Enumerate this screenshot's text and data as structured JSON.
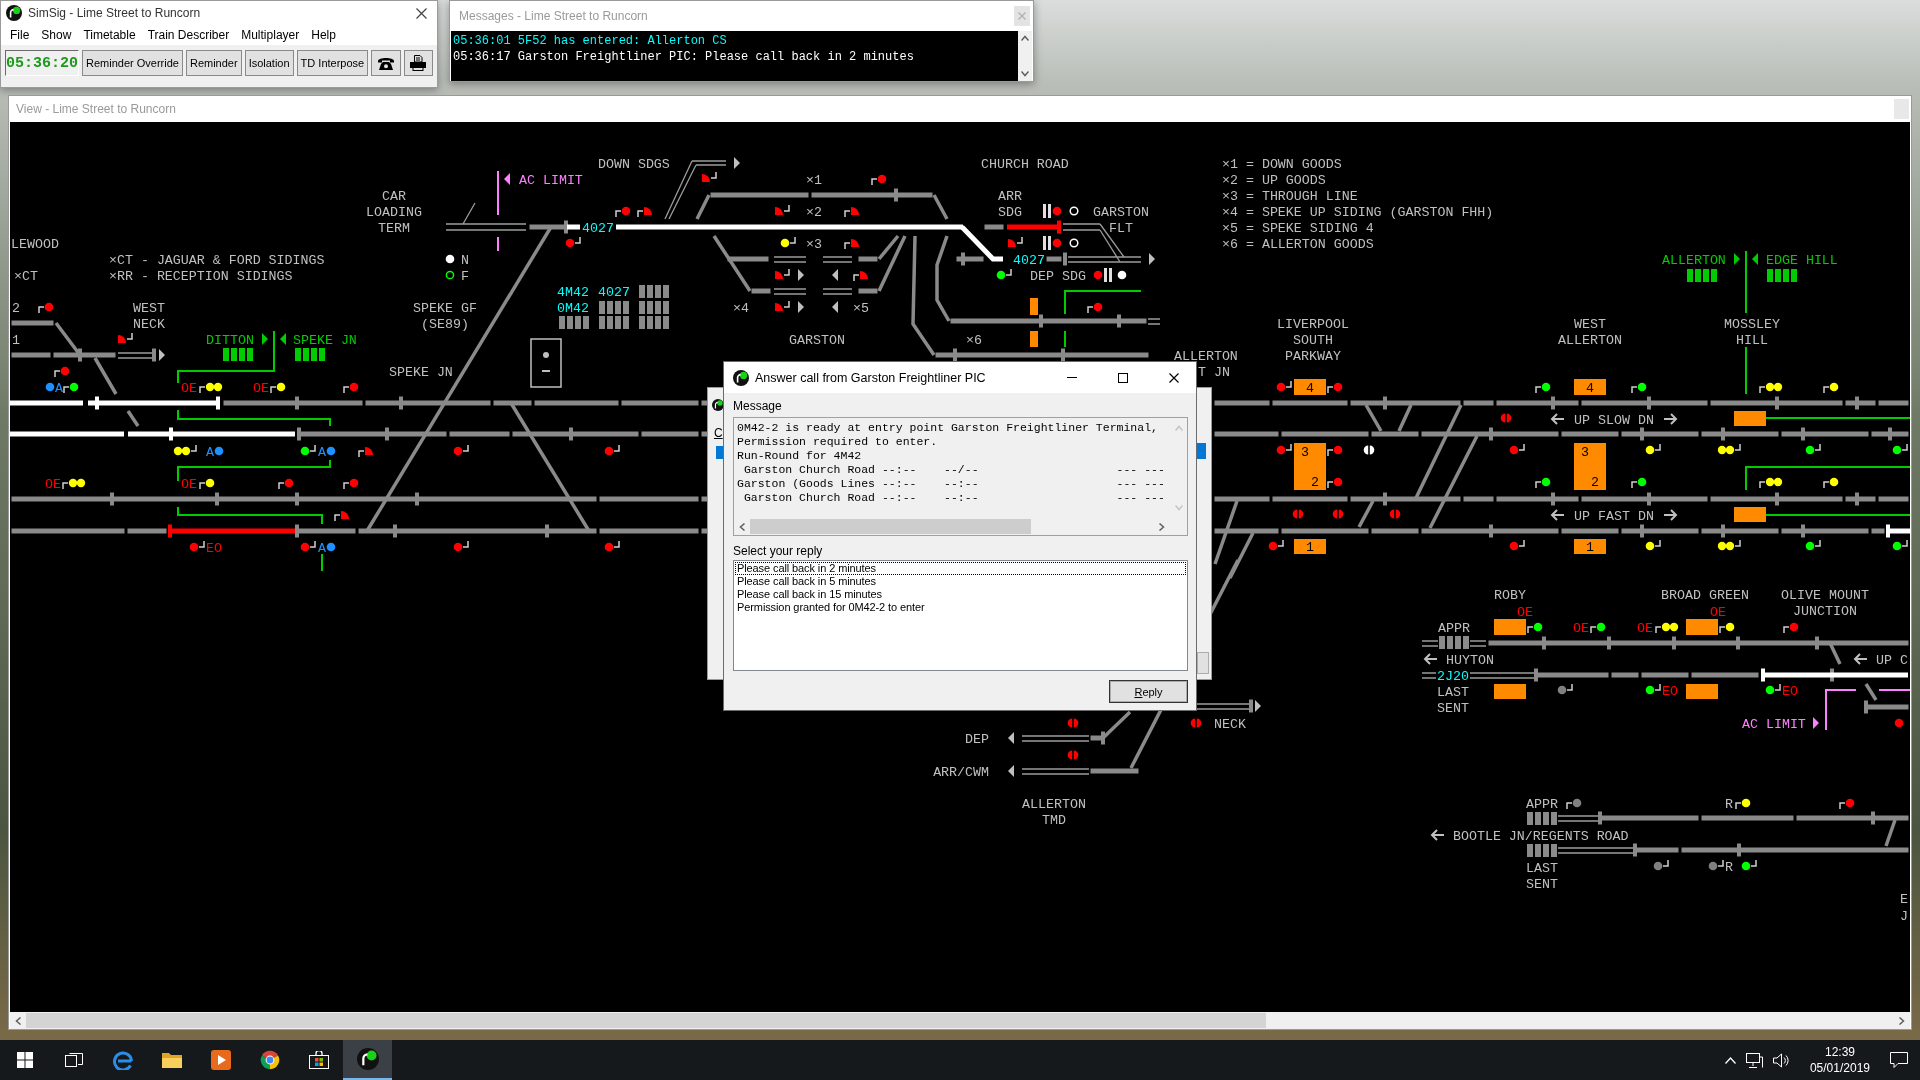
{
  "main_window": {
    "title": "SimSig - Lime Street to Runcorn",
    "menu": [
      "File",
      "Show",
      "Timetable",
      "Train Describer",
      "Multiplayer",
      "Help"
    ],
    "clock": "05:36:20",
    "toolbar": [
      {
        "kind": "text",
        "label": "Reminder Override"
      },
      {
        "kind": "text",
        "label": "Reminder"
      },
      {
        "kind": "text",
        "label": "Isolation"
      },
      {
        "kind": "text",
        "label": "TD Interpose"
      },
      {
        "kind": "phone"
      },
      {
        "kind": "printer"
      }
    ]
  },
  "messages_window": {
    "title": "Messages - Lime Street to Runcorn",
    "lines": [
      {
        "text": "05:36:01 5F52 has entered: Allerton CS",
        "color": "#00ffff"
      },
      {
        "text": "05:36:17 Garston Freightliner PIC: Please call back in 2 minutes",
        "color": "#ffffff"
      }
    ]
  },
  "view_window": {
    "title": "View - Lime Street to Runcorn",
    "schematic": {
      "labels": [
        {
          "kind": "name",
          "text": "DOWN SDGS"
        },
        {
          "kind": "name",
          "text": "CHURCH ROAD"
        },
        {
          "kind": "limit",
          "text": "AC LIMIT"
        },
        {
          "kind": "marker",
          "text": "×1"
        },
        {
          "kind": "name",
          "lines": [
            "CAR",
            "LOADING",
            "TERM"
          ]
        },
        {
          "kind": "marker",
          "text": "×2"
        },
        {
          "kind": "name",
          "lines": [
            "ARR",
            "SDG"
          ]
        },
        {
          "kind": "name",
          "lines": [
            "GARSTON",
            "FLT"
          ]
        },
        {
          "kind": "name",
          "text": "LEWOOD"
        },
        {
          "kind": "marker",
          "text": "×3"
        },
        {
          "kind": "name",
          "text": "×CT - JAGUAR & FORD SIDINGS"
        },
        {
          "kind": "key",
          "text": "N"
        },
        {
          "kind": "fringe",
          "text": "ALLERTON"
        },
        {
          "kind": "fringe",
          "text": "EDGE HILL"
        },
        {
          "kind": "name",
          "text": "×CT"
        },
        {
          "kind": "name",
          "text": "×RR - RECEPTION SIDINGS"
        },
        {
          "kind": "key",
          "text": "F"
        },
        {
          "kind": "name",
          "text": "DEP SDG"
        },
        {
          "kind": "number",
          "text": "2"
        },
        {
          "kind": "name",
          "lines": [
            "WEST",
            "NECK"
          ]
        },
        {
          "kind": "name",
          "lines": [
            "SPEKE GF",
            "(SE89)"
          ]
        },
        {
          "kind": "marker",
          "text": "×4"
        },
        {
          "kind": "marker",
          "text": "×5"
        },
        {
          "kind": "number",
          "text": "1"
        },
        {
          "kind": "fringe",
          "text": "DITTON"
        },
        {
          "kind": "fringe",
          "text": "SPEKE JN"
        },
        {
          "kind": "name",
          "text": "GARSTON"
        },
        {
          "kind": "marker",
          "text": "×6"
        },
        {
          "kind": "name",
          "lines": [
            "LIVERPOOL",
            "SOUTH",
            "PARKWAY"
          ]
        },
        {
          "kind": "name",
          "lines": [
            "WEST",
            "ALLERTON"
          ]
        },
        {
          "kind": "name",
          "lines": [
            "MOSSLEY",
            "HILL"
          ]
        },
        {
          "kind": "name",
          "text": "ALLERTON"
        },
        {
          "kind": "name",
          "text": "SPEKE JN"
        },
        {
          "kind": "name",
          "text": "T JN"
        },
        {
          "kind": "name",
          "text": "UP SLOW DN"
        },
        {
          "kind": "name",
          "text": "UP FAST DN"
        },
        {
          "kind": "name",
          "text": "ROBY"
        },
        {
          "kind": "name",
          "text": "BROAD GREEN"
        },
        {
          "kind": "name",
          "lines": [
            "OLIVE MOUNT",
            "JUNCTION"
          ]
        },
        {
          "kind": "name",
          "text": "APPR"
        },
        {
          "kind": "name",
          "text": "HUYTON"
        },
        {
          "kind": "name",
          "text": "UP C"
        },
        {
          "kind": "name",
          "lines": [
            "LAST",
            "SENT"
          ]
        },
        {
          "kind": "name",
          "text": "NECK"
        },
        {
          "kind": "limit",
          "text": "AC LIMIT"
        },
        {
          "kind": "name",
          "text": "DEP"
        },
        {
          "kind": "name",
          "text": "ARR/CWM"
        },
        {
          "kind": "name",
          "lines": [
            "ALLERTON",
            "TMD"
          ]
        },
        {
          "kind": "name",
          "text": "APPR"
        },
        {
          "kind": "name",
          "text": "BOOTLE JN/REGENTS ROAD"
        },
        {
          "kind": "name",
          "lines": [
            "LAST",
            "SENT"
          ]
        },
        {
          "kind": "name",
          "text": "E"
        },
        {
          "kind": "name",
          "text": "J"
        }
      ],
      "legend": [
        "×1 = DOWN GOODS",
        "×2 = UP GOODS",
        "×3 = THROUGH LINE",
        "×4 = SPEKE UP SIDING (GARSTON FHH)",
        "×5 = SPEKE SIDING 4",
        "×6 = ALLERTON GOODS"
      ],
      "train_ids": [
        {
          "text": "4027"
        },
        {
          "text": "4M42"
        },
        {
          "text": "4027"
        },
        {
          "text": "0M42"
        },
        {
          "text": "4027"
        },
        {
          "text": "2J20"
        }
      ],
      "route_letters": [
        {
          "text": "A",
          "color": "#1e90ff"
        },
        {
          "text": "OE",
          "color": "#ff0000"
        },
        {
          "text": "OE",
          "color": "#ff0000"
        },
        {
          "text": "A",
          "color": "#1e90ff"
        },
        {
          "text": "A",
          "color": "#1e90ff"
        },
        {
          "text": "OE",
          "color": "#ff0000"
        },
        {
          "text": "OE",
          "color": "#ff0000"
        },
        {
          "text": "EO",
          "color": "#ff0000"
        },
        {
          "text": "A",
          "color": "#1e90ff"
        },
        {
          "text": "OE",
          "color": "#ff0000"
        },
        {
          "text": "OE",
          "color": "#ff0000"
        },
        {
          "text": "OE",
          "color": "#ff0000"
        },
        {
          "text": "OE",
          "color": "#ff0000"
        },
        {
          "text": "EO",
          "color": "#ff0000"
        },
        {
          "text": "EO",
          "color": "#ff0000"
        },
        {
          "text": "R",
          "color": "#c0c0c0"
        },
        {
          "text": "R",
          "color": "#c0c0c0"
        }
      ],
      "signals": [
        {
          "kind": "main",
          "color": "#ff0000"
        },
        {
          "kind": "shunt",
          "color": "#ff0000"
        },
        {
          "kind": "main",
          "color": "#ff0000"
        },
        {
          "kind": "main",
          "color": "#1e90ff"
        },
        {
          "kind": "main",
          "color": "#00ff00"
        },
        {
          "kind": "double",
          "color": "#ffff00"
        },
        {
          "kind": "main",
          "color": "#ffff00"
        },
        {
          "kind": "main",
          "color": "#ff0000"
        },
        {
          "kind": "double",
          "color": "#ffff00"
        },
        {
          "kind": "main",
          "color": "#1e90ff"
        },
        {
          "kind": "main",
          "color": "#00ff00"
        },
        {
          "kind": "main",
          "color": "#1e90ff"
        },
        {
          "kind": "shunt",
          "color": "#ff0000"
        },
        {
          "kind": "main",
          "color": "#ff0000"
        },
        {
          "kind": "main",
          "color": "#ff0000"
        },
        {
          "kind": "double",
          "color": "#ffff00"
        },
        {
          "kind": "main",
          "color": "#ffff00"
        },
        {
          "kind": "main",
          "color": "#ff0000"
        },
        {
          "kind": "main",
          "color": "#ff0000"
        },
        {
          "kind": "shunt",
          "color": "#ff0000"
        },
        {
          "kind": "main",
          "color": "#ff0000"
        },
        {
          "kind": "main",
          "color": "#ff0000"
        },
        {
          "kind": "main",
          "color": "#1e90ff"
        },
        {
          "kind": "main",
          "color": "#ff0000"
        },
        {
          "kind": "main",
          "color": "#ff0000"
        },
        {
          "kind": "shunt",
          "color": "#ff0000"
        },
        {
          "kind": "main",
          "color": "#ff0000"
        },
        {
          "kind": "shunt",
          "color": "#ff0000"
        },
        {
          "kind": "main",
          "color": "#ff0000"
        },
        {
          "kind": "main",
          "color": "#ff0000"
        },
        {
          "kind": "shunt",
          "color": "#ff0000"
        },
        {
          "kind": "shunt",
          "color": "#ff0000"
        },
        {
          "kind": "main",
          "color": "#ffff00"
        },
        {
          "kind": "shunt",
          "color": "#ff0000"
        },
        {
          "kind": "shunt",
          "color": "#ff0000"
        },
        {
          "kind": "shunt",
          "color": "#ff0000"
        },
        {
          "kind": "shunt",
          "color": "#ff0000"
        },
        {
          "kind": "barred",
          "color": "#ff0000"
        },
        {
          "kind": "ring",
          "color": "#ffffff"
        },
        {
          "kind": "shunt",
          "color": "#ff0000"
        },
        {
          "kind": "barred",
          "color": "#ff0000"
        },
        {
          "kind": "ring",
          "color": "#ffffff"
        },
        {
          "kind": "main",
          "color": "#00ff00"
        },
        {
          "kind": "barred",
          "color": "#ff0000"
        },
        {
          "kind": "main",
          "color": "#ffffff"
        },
        {
          "kind": "main",
          "color": "#ff0000"
        },
        {
          "kind": "main",
          "color": "#ff0000"
        },
        {
          "kind": "main",
          "color": "#ff0000"
        },
        {
          "kind": "main",
          "color": "#00ff00"
        },
        {
          "kind": "main",
          "color": "#00ff00"
        },
        {
          "kind": "double",
          "color": "#ffff00"
        },
        {
          "kind": "main",
          "color": "#ffff00"
        },
        {
          "kind": "half",
          "color": "#ff0000"
        },
        {
          "kind": "main",
          "color": "#ff0000"
        },
        {
          "kind": "main",
          "color": "#ff0000"
        },
        {
          "kind": "half",
          "color": "#ffffff"
        },
        {
          "kind": "main",
          "color": "#ff0000"
        },
        {
          "kind": "main",
          "color": "#ffff00"
        },
        {
          "kind": "double",
          "color": "#ffff00"
        },
        {
          "kind": "main",
          "color": "#00ff00"
        },
        {
          "kind": "main",
          "color": "#00ff00"
        },
        {
          "kind": "main",
          "color": "#ff0000"
        },
        {
          "kind": "main",
          "color": "#00ff00"
        },
        {
          "kind": "main",
          "color": "#00ff00"
        },
        {
          "kind": "double",
          "color": "#ffff00"
        },
        {
          "kind": "main",
          "color": "#ffff00"
        },
        {
          "kind": "half",
          "color": "#ff0000"
        },
        {
          "kind": "half",
          "color": "#ff0000"
        },
        {
          "kind": "half",
          "color": "#ff0000"
        },
        {
          "kind": "main",
          "color": "#ff0000"
        },
        {
          "kind": "main",
          "color": "#ff0000"
        },
        {
          "kind": "main",
          "color": "#ffff00"
        },
        {
          "kind": "double",
          "color": "#ffff00"
        },
        {
          "kind": "main",
          "color": "#00ff00"
        },
        {
          "kind": "main",
          "color": "#00ff00"
        },
        {
          "kind": "main",
          "color": "#00ff00"
        },
        {
          "kind": "main",
          "color": "#00ff00"
        },
        {
          "kind": "double",
          "color": "#ffff00"
        },
        {
          "kind": "main",
          "color": "#ffff00"
        },
        {
          "kind": "main",
          "color": "#ff0000"
        },
        {
          "kind": "main",
          "color": "#808080"
        },
        {
          "kind": "main",
          "color": "#00ff00"
        },
        {
          "kind": "main",
          "color": "#00ff00"
        },
        {
          "kind": "main",
          "color": "#ff0000"
        },
        {
          "kind": "half",
          "color": "#ff0000"
        },
        {
          "kind": "half",
          "color": "#ff0000"
        },
        {
          "kind": "half",
          "color": "#ff0000"
        },
        {
          "kind": "main",
          "color": "#808080"
        },
        {
          "kind": "main",
          "color": "#ffff00"
        },
        {
          "kind": "main",
          "color": "#ff0000"
        },
        {
          "kind": "main",
          "color": "#808080"
        },
        {
          "kind": "main",
          "color": "#808080"
        },
        {
          "kind": "main",
          "color": "#00ff00"
        }
      ],
      "platforms": [
        {
          "numbers": [
            "4"
          ]
        },
        {
          "numbers": [
            "4"
          ]
        },
        {
          "numbers": [
            "3",
            "2"
          ]
        },
        {
          "numbers": [
            "3",
            "2"
          ]
        },
        {
          "numbers": [
            "1"
          ]
        },
        {
          "numbers": [
            "1"
          ]
        }
      ],
      "track_sections": [
        {
          "route_set": true,
          "occupied": false
        },
        {
          "route_set": true,
          "occupied": false
        },
        {
          "route_set": true,
          "occupied": false
        },
        {
          "route_set": true,
          "occupied": false
        },
        {
          "route_set": false,
          "occupied": true
        },
        {
          "route_set": true,
          "occupied": false
        },
        {
          "route_set": true,
          "occupied": false
        },
        {
          "route_set": false,
          "occupied": true
        },
        {
          "route_set": true,
          "occupied": false
        },
        {
          "route_set": true,
          "occupied": false
        }
      ]
    }
  },
  "background_window": {
    "label": "C"
  },
  "dialog": {
    "title": "Answer call from Garston Freightliner PIC",
    "message_label": "Message",
    "message_lines": [
      "0M42-2 is ready at entry point Garston Freightliner Terminal,",
      "Permission required to enter.",
      "Run-Round for 4M42",
      " Garston Church Road --:--    --/--                    --- ---",
      "Garston (Goods Lines --:--    --:--                    --- ---",
      " Garston Church Road --:--    --:--                    --- ---"
    ],
    "reply_label": "Select your reply",
    "replies": [
      {
        "text": "Please call back in 2 minutes",
        "selected": true
      },
      {
        "text": "Please call back in 5 minutes",
        "selected": false
      },
      {
        "text": "Please call back in 15 minutes",
        "selected": false
      },
      {
        "text": "Permission granted for 0M42-2 to enter",
        "selected": false
      }
    ],
    "button": "Reply"
  },
  "taskbar": {
    "apps": [
      {
        "kind": "windows-logo",
        "active": false
      },
      {
        "kind": "task-view",
        "active": false
      },
      {
        "kind": "e-logo",
        "active": false
      },
      {
        "kind": "folder",
        "active": false
      },
      {
        "kind": "media-player",
        "active": false
      },
      {
        "kind": "round-logo",
        "active": false
      },
      {
        "kind": "shopping-bag",
        "active": false
      },
      {
        "kind": "app-logo",
        "active": true
      }
    ],
    "time": "12:39",
    "date": "05/01/2019"
  }
}
